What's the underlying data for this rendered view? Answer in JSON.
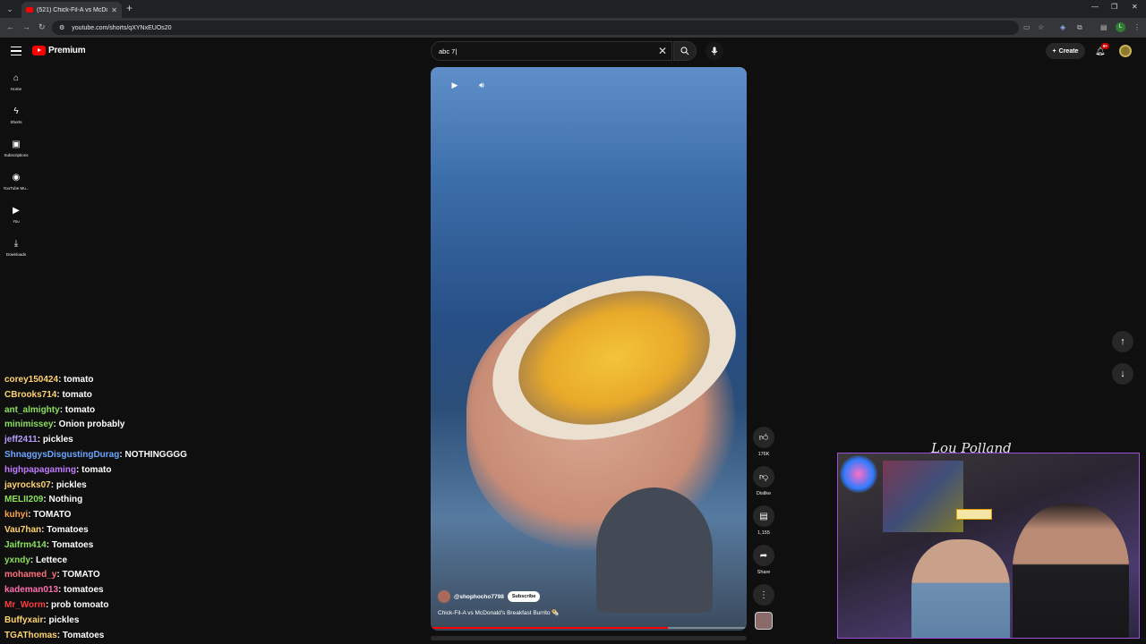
{
  "browser": {
    "tab_title": "(521) Chick-Fil-A vs McDonald's",
    "url": "youtube.com/shorts/qXYNxEUOs20",
    "profile_initial": "L"
  },
  "header": {
    "logo_text": "Premium",
    "search_value": "abc 7|",
    "create_label": "Create",
    "notif_count": "9+"
  },
  "sidebar": {
    "items": [
      {
        "label": "Home",
        "icon": "home-icon"
      },
      {
        "label": "Shorts",
        "icon": "shorts-icon"
      },
      {
        "label": "Subscriptions",
        "icon": "subscriptions-icon"
      },
      {
        "label": "YouTube Mu...",
        "icon": "youtube-music-icon"
      },
      {
        "label": "You",
        "icon": "you-icon"
      },
      {
        "label": "Downloads",
        "icon": "download-icon"
      }
    ]
  },
  "short": {
    "channel": "@shophocho7798",
    "subscribe_label": "Subscribe",
    "title": "Chick-Fil-A vs McDonald's Breakfast Burrito 🌯",
    "progress": 0.75
  },
  "actions": {
    "likes": "176K",
    "dislike_label": "Dislike",
    "comments": "1,155",
    "share_label": "Share"
  },
  "chat": [
    {
      "user": "corey150424",
      "msg": "tomato",
      "color": "#ffd36e"
    },
    {
      "user": "CBrooks714",
      "msg": "tomato",
      "color": "#ffd36e"
    },
    {
      "user": "ant_almighty",
      "msg": "tomato",
      "color": "#8bdf5d"
    },
    {
      "user": "minimissey",
      "msg": "Onion probably",
      "color": "#8bdf5d"
    },
    {
      "user": "jeff2411",
      "msg": "pickles",
      "color": "#b79cff"
    },
    {
      "user": "ShnaggysDisgustingDurag",
      "msg": "NOTHINGGGG",
      "color": "#6aa6ff"
    },
    {
      "user": "highpapagaming",
      "msg": "tomato",
      "color": "#c27bff"
    },
    {
      "user": "jayrocks07",
      "msg": "pickles",
      "color": "#ffd36e"
    },
    {
      "user": "MELII209",
      "msg": "Nothing",
      "color": "#8bdf5d"
    },
    {
      "user": "kuhyi",
      "msg": "TOMATO",
      "color": "#ffa24a"
    },
    {
      "user": "Vau7han",
      "msg": "Tomatoes",
      "color": "#ffd36e"
    },
    {
      "user": "Jaifrm414",
      "msg": "Tomatoes",
      "color": "#8bdf5d"
    },
    {
      "user": "yxndy",
      "msg": "Lettece",
      "color": "#8bdf5d"
    },
    {
      "user": "mohamed_y",
      "msg": "TOMATO",
      "color": "#ff6f7d"
    },
    {
      "user": "kademan013",
      "msg": "tomatoes",
      "color": "#ff6fb0"
    },
    {
      "user": "Mr_Worm",
      "msg": "prob tomoato",
      "color": "#ff3b3b"
    },
    {
      "user": "Buffyxair",
      "msg": "pickles",
      "color": "#ffd36e"
    },
    {
      "user": "TGAThomas",
      "msg": "Tomatoes",
      "color": "#ffd36e"
    }
  ]
}
